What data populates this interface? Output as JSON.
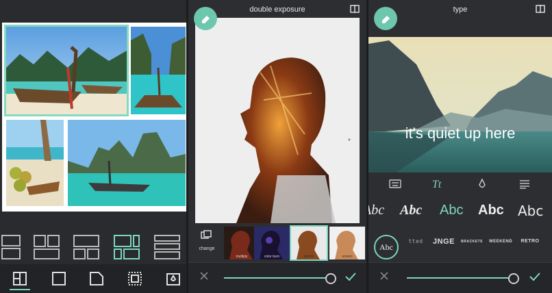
{
  "colors": {
    "accent": "#6cc7ad",
    "panel_bg": "#2d2e31",
    "bar_bg": "#252629"
  },
  "panel1": {
    "layouts": [
      "layout-split-icon",
      "layout-grid-icon",
      "layout-mosaic-icon",
      "layout-featured-icon",
      "layout-stack-icon"
    ],
    "tools": [
      "collage-tab-icon",
      "border-tab-icon",
      "corner-tab-icon",
      "spacing-tab-icon",
      "background-tab-icon"
    ]
  },
  "panel2": {
    "title": "double exposure",
    "change_label": "change",
    "blend_modes": [
      "multiply",
      "color burn",
      "lighten",
      "screen"
    ],
    "selected_mode": "lighten",
    "opacity": 0.9
  },
  "panel3": {
    "title": "type",
    "overlay_text": "it's quiet up here",
    "tabs": [
      "keyboard-icon",
      "font-style-icon",
      "color-drop-icon",
      "align-icon"
    ],
    "fonts": [
      "Abc",
      "Abc",
      "Abc",
      "Abc",
      "Abc"
    ],
    "selected_font": 2,
    "styles": [
      "Abc",
      "tted",
      "JNGE",
      "BRACKETS",
      "WEEKEND",
      "RETRO"
    ],
    "opacity": 0.85
  }
}
